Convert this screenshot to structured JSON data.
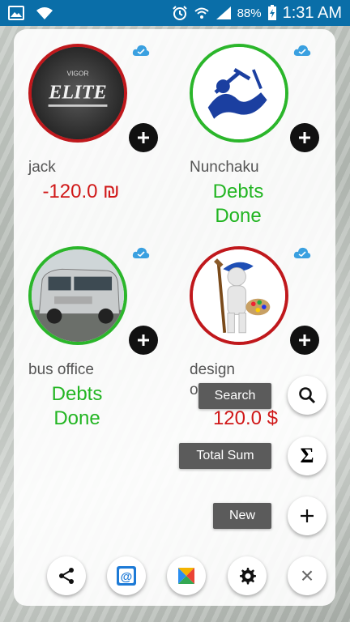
{
  "status_bar": {
    "battery": "88%",
    "time": "1:31 AM"
  },
  "contacts": [
    {
      "name": "jack",
      "status": "-120.0 ₪"
    },
    {
      "name": "Nunchaku",
      "status_line1": "Debts",
      "status_line2": "Done"
    },
    {
      "name": "bus office",
      "status_line1": "Debts",
      "status_line2": "Done"
    },
    {
      "name": "design office",
      "status": "120.0 $"
    }
  ],
  "avatar_texts": {
    "jack_logo_top": "VIGOR",
    "jack_logo": "ELITE"
  },
  "fab_menu": {
    "search_label": "Search",
    "total_sum_label": "Total Sum",
    "new_label": "New",
    "sigma_symbol": "Σ",
    "plus_symbol": "+",
    "close_symbol": "×"
  },
  "colors": {
    "status_bar": "#0a6ea8",
    "debts_done": "#22b522",
    "debt_amount": "#d01818",
    "ring_green": "#2bb62b",
    "ring_red": "#c0181c"
  }
}
